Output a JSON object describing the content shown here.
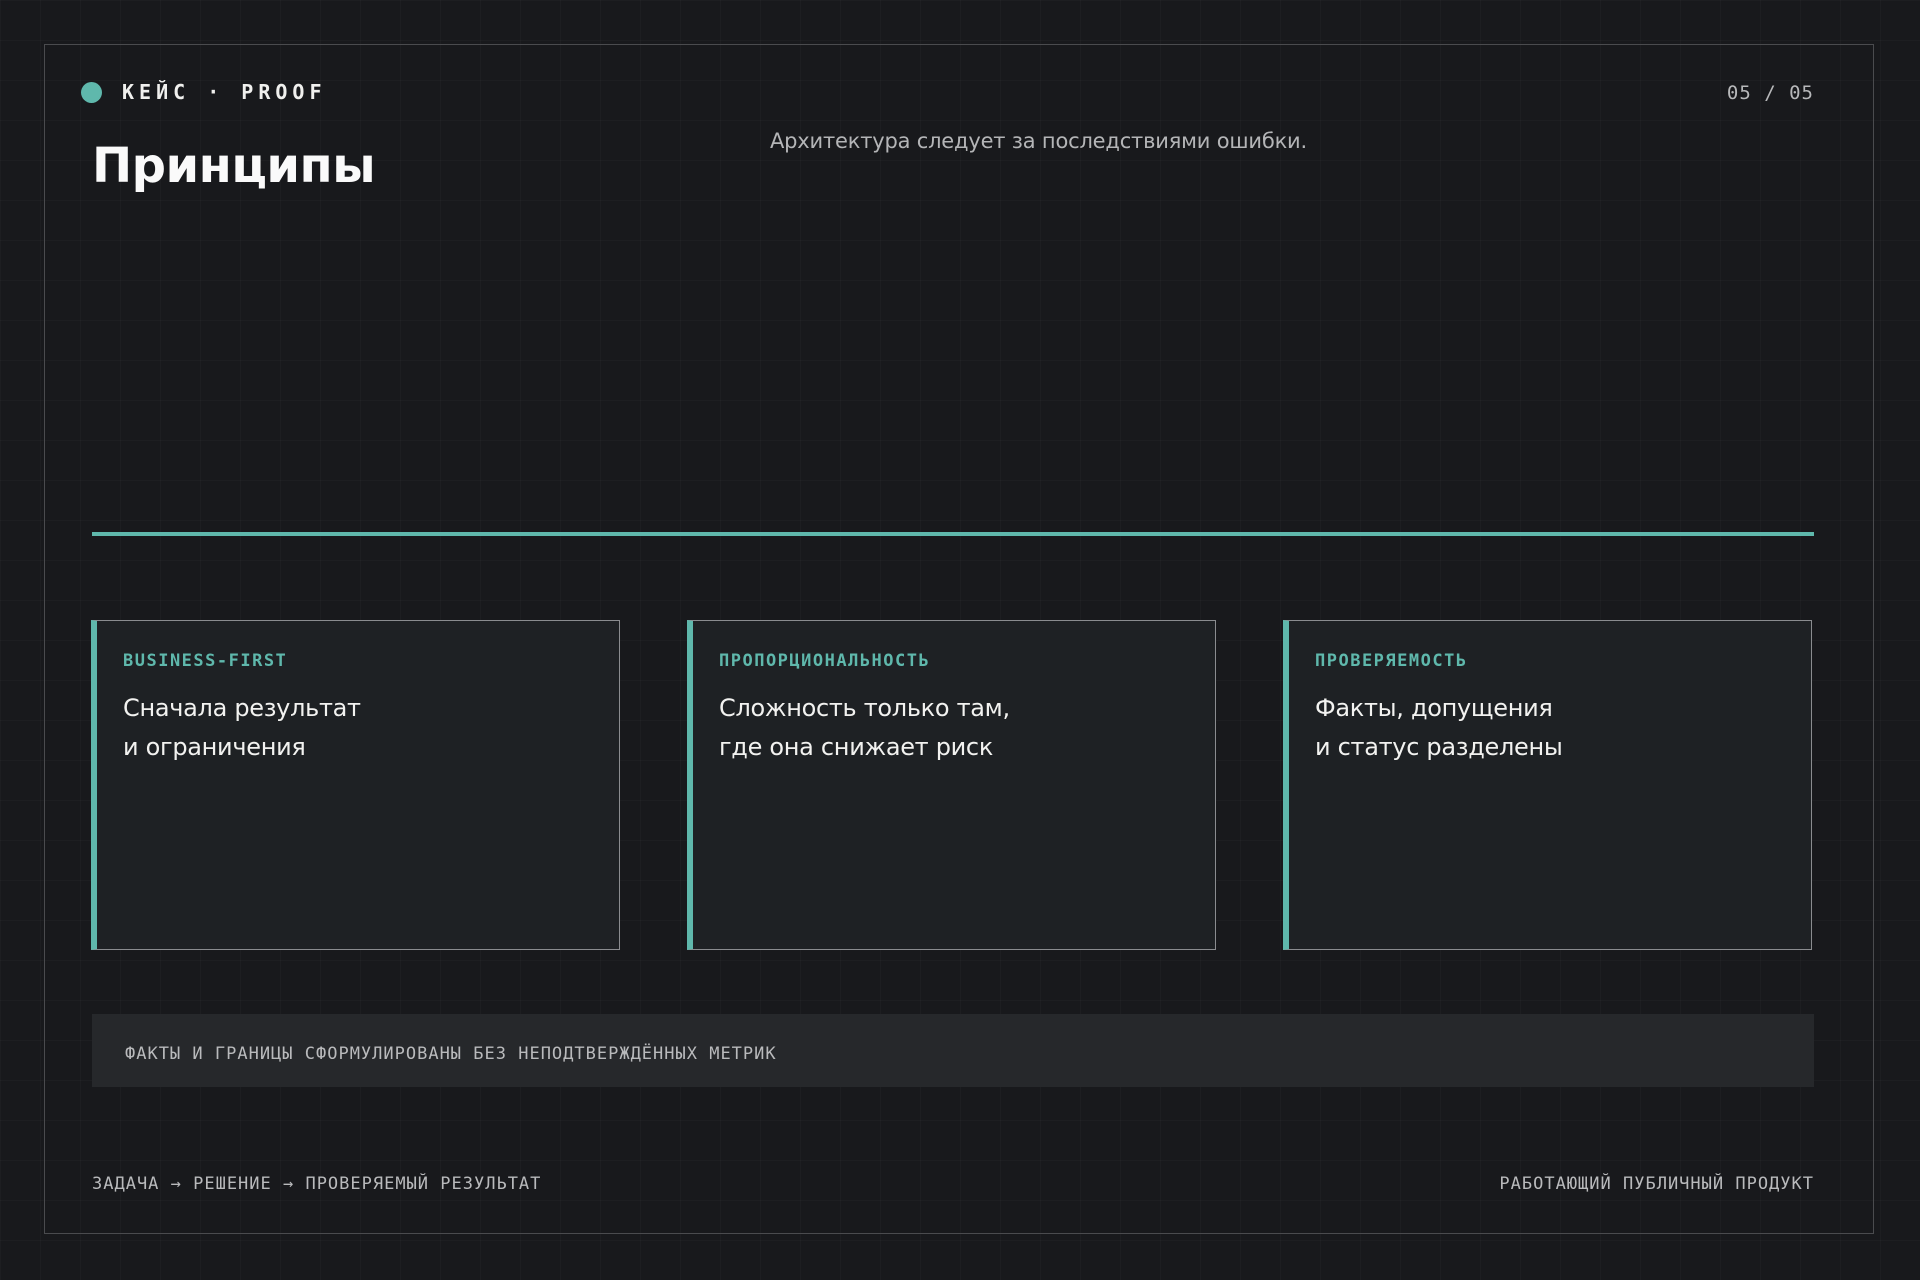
{
  "header": {
    "brand": "КЕЙС · PROOF",
    "page_counter": "05 / 05"
  },
  "title": "Принципы",
  "subtitle": "Архитектура следует за последствиями ошибки.",
  "colors": {
    "accent": "#5fb8ac",
    "background": "#18191c",
    "card_background": "#1e2124"
  },
  "cards": [
    {
      "label": "BUSINESS-FIRST",
      "line1": "Сначала результат",
      "line2": "и ограничения"
    },
    {
      "label": "ПРОПОРЦИОНАЛЬНОСТЬ",
      "line1": "Сложность только там,",
      "line2": "где она снижает риск"
    },
    {
      "label": "ПРОВЕРЯЕМОСТЬ",
      "line1": "Факты, допущения",
      "line2": "и статус разделены"
    }
  ],
  "notice": "ФАКТЫ И ГРАНИЦЫ СФОРМУЛИРОВАНЫ БЕЗ НЕПОДТВЕРЖДЁННЫХ МЕТРИК",
  "footer": {
    "left": "ЗАДАЧА → РЕШЕНИЕ → ПРОВЕРЯЕМЫЙ РЕЗУЛЬТАТ",
    "right": "РАБОТАЮЩИЙ ПУБЛИЧНЫЙ ПРОДУКТ"
  }
}
